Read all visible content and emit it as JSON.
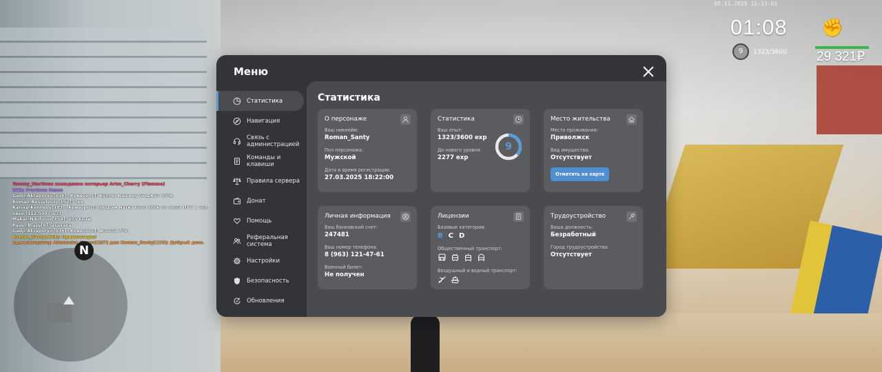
{
  "hud": {
    "datetime": "05.11.2025 15:33:03",
    "clock": "01:08",
    "level": "9",
    "exp_short": "1323/3600",
    "money": "29 321₽"
  },
  "chat": [
    {
      "text": "Tommy_Martinez вхождение интерьер Artm_Cherry (Flamme)",
      "color": "#ff4f6a"
    },
    {
      "text": "MTA: Province Demo",
      "color": "#c77dff"
    },
    {
      "text": "Gadji_Akraporvic[136] [Криворот]: Куплю машину бюджет 750к",
      "color": "#ffffff"
    },
    {
      "text": "Roman_Resselerov[152]: 7кк",
      "color": "#ffffff"
    },
    {
      "text": "Karina_Kennedy[183] [Криворот]: Продам матиз бсос 100к от госса ПТС 1 чел",
      "color": "#ffffff"
    },
    {
      "text": "овек (112.500 госс)",
      "color": "#ffffff"
    },
    {
      "text": "Makar_Nikiforov[154]: 275 край",
      "color": "#ffffff"
    },
    {
      "text": "Pavel_Blaze[6]: ахахаха",
      "color": "#ffffff"
    },
    {
      "text": "Gadji_Akraporvic[136] [Криворот]: монета 70к",
      "color": "#ffffff"
    },
    {
      "text": "Roman_Santy[123]: Приветствую!",
      "color": "#ffd633"
    },
    {
      "text": "Администратор Alexander_Zonov[187] для Roman_Santy[123]: Добрый день",
      "color": "#ffa347"
    }
  ],
  "minimap": {
    "north": "N"
  },
  "menu": {
    "title": "Меню",
    "sidebar": [
      {
        "label": "Статистика",
        "icon": "pie-chart-icon",
        "active": true
      },
      {
        "label": "Навигация",
        "icon": "compass-icon"
      },
      {
        "label": "Связь с администрацией",
        "icon": "headset-icon"
      },
      {
        "label": "Команды и клавиши",
        "icon": "document-icon"
      },
      {
        "label": "Правила сервера",
        "icon": "scales-icon"
      },
      {
        "label": "Донат",
        "icon": "wallet-icon"
      },
      {
        "label": "Помощь",
        "icon": "heart-hand-icon"
      },
      {
        "label": "Реферальная система",
        "icon": "users-icon"
      },
      {
        "label": "Настройки",
        "icon": "gear-icon"
      },
      {
        "label": "Безопасность",
        "icon": "shield-icon"
      },
      {
        "label": "Обновления",
        "icon": "refresh-icon"
      }
    ],
    "content_title": "Статистика",
    "cards": {
      "character": {
        "title": "О персонаже",
        "icon": "person-icon",
        "nickname_label": "Ваш никнейм:",
        "nickname": "Roman_Santy",
        "gender_label": "Пол персонажа:",
        "gender": "Мужской",
        "reg_label": "Дата и время регистрации:",
        "reg": "27.03.2025 18:22:00"
      },
      "stats": {
        "title": "Статистика",
        "icon": "clock-icon",
        "exp_label": "Ваш опыт:",
        "exp": "1323/3600 exp",
        "next_label": "До нового уровня:",
        "next": "2277 exp",
        "level": "9",
        "progress": 0.3675
      },
      "residence": {
        "title": "Место жительства",
        "icon": "house-icon",
        "place_label": "Место проживания:",
        "place": "Приволжск",
        "property_label": "Вид имущества:",
        "property": "Отсутствует",
        "button": "Отметить на карте"
      },
      "personal": {
        "title": "Личная информация",
        "icon": "user-circle-icon",
        "bank_label": "Ваш банковский счет:",
        "bank": "247481",
        "phone_label": "Ваш номер телефона:",
        "phone": "8 (963) 121-47-61",
        "military_label": "Военный билет:",
        "military": "Не получен"
      },
      "licenses": {
        "title": "Лицензии",
        "icon": "license-icon",
        "base_label": "Базовые категории:",
        "categories": [
          {
            "letter": "B",
            "active": true
          },
          {
            "letter": "C",
            "active": false
          },
          {
            "letter": "D",
            "active": false
          }
        ],
        "public_label": "Общественный транспорт:",
        "air_label": "Воздушный и водный транспорт:"
      },
      "job": {
        "title": "Трудоустройство",
        "icon": "hammer-icon",
        "position_label": "Ваша должность:",
        "position": "Безработный",
        "city_label": "Город трудоустройства:",
        "city": "Отсутствует"
      }
    }
  },
  "accent": "#5b9bd5"
}
